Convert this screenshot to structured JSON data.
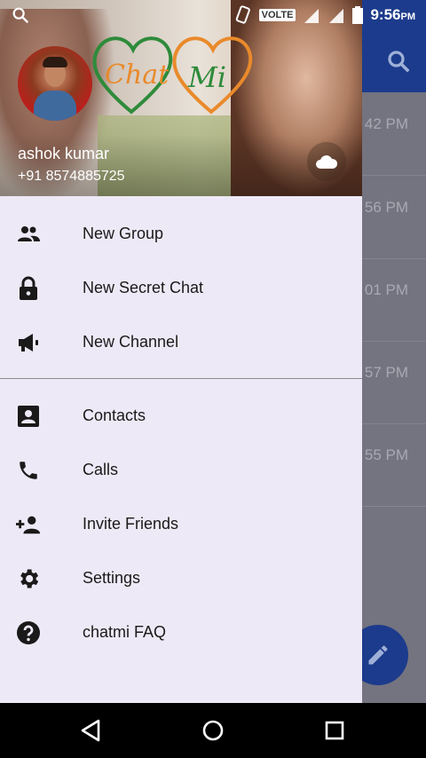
{
  "status_bar": {
    "network": "VOLTE",
    "time": "9:56",
    "ampm": "PM"
  },
  "background": {
    "times": [
      "42 PM",
      "56 PM",
      "01 PM",
      "57 PM",
      "55 PM"
    ]
  },
  "drawer": {
    "header": {
      "logo_text_left": "Chat",
      "logo_text_right": "Mi",
      "user_name": "ashok kumar",
      "phone": "+91 8574885725"
    },
    "primary_items": [
      {
        "label": "New Group",
        "icon": "group-icon"
      },
      {
        "label": "New Secret Chat",
        "icon": "lock-icon"
      },
      {
        "label": "New Channel",
        "icon": "megaphone-icon"
      }
    ],
    "secondary_items": [
      {
        "label": "Contacts",
        "icon": "contact-card-icon"
      },
      {
        "label": "Calls",
        "icon": "phone-icon"
      },
      {
        "label": "Invite Friends",
        "icon": "person-add-icon"
      },
      {
        "label": "Settings",
        "icon": "gear-icon"
      },
      {
        "label": "chatmi FAQ",
        "icon": "help-icon"
      }
    ]
  },
  "colors": {
    "accent": "#1c3b8c",
    "drawer_bg": "#eee9f6",
    "icon": "#1a1a1a"
  }
}
